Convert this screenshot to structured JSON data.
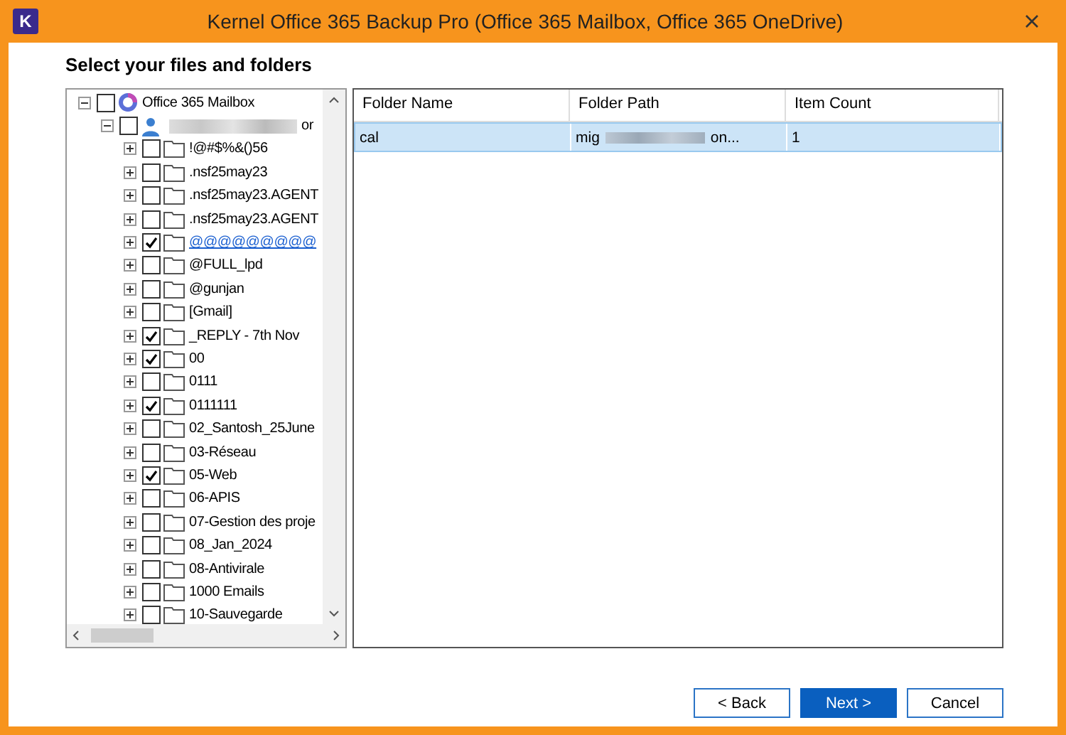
{
  "window": {
    "title": "Kernel Office 365 Backup Pro (Office 365 Mailbox, Office 365 OneDrive)",
    "logo": "K"
  },
  "heading": "Select your files and folders",
  "tree": {
    "label": "Office 365 Mailbox",
    "checked": false,
    "expanded": true,
    "children": [
      {
        "label": "or",
        "redacted": true,
        "checked": false,
        "expanded": true,
        "children": [
          {
            "label": "!@#$%&()56",
            "checked": false
          },
          {
            "label": ".nsf25may23",
            "checked": false
          },
          {
            "label": ".nsf25may23.AGENT",
            "checked": false
          },
          {
            "label": ".nsf25may23.AGENT",
            "checked": false
          },
          {
            "label": "@@@@@@@@@",
            "checked": true,
            "link": true
          },
          {
            "label": "@FULL_lpd",
            "checked": false
          },
          {
            "label": "@gunjan",
            "checked": false
          },
          {
            "label": "[Gmail]",
            "checked": false
          },
          {
            "label": "_REPLY - 7th Nov",
            "checked": true
          },
          {
            "label": "00",
            "checked": true
          },
          {
            "label": "0111",
            "checked": false
          },
          {
            "label": "0111111",
            "checked": true
          },
          {
            "label": "02_Santosh_25June",
            "checked": false
          },
          {
            "label": "03-Réseau",
            "checked": false
          },
          {
            "label": "05-Web",
            "checked": true
          },
          {
            "label": "06-APIS",
            "checked": false
          },
          {
            "label": "07-Gestion des proje",
            "checked": false
          },
          {
            "label": "08_Jan_2024",
            "checked": false
          },
          {
            "label": "08-Antivirale",
            "checked": false
          },
          {
            "label": "1000 Emails",
            "checked": false
          },
          {
            "label": "10-Sauvegarde",
            "checked": false
          }
        ]
      }
    ]
  },
  "table": {
    "columns": [
      "Folder Name",
      "Folder Path",
      "Item Count"
    ],
    "rows": [
      {
        "cells": [
          "cal",
          "mig",
          "on...",
          "1"
        ],
        "selected": true
      }
    ]
  },
  "buttons": [
    {
      "label": "< Back",
      "primary": false
    },
    {
      "label": "Next >",
      "primary": true
    },
    {
      "label": "Cancel",
      "primary": false
    }
  ]
}
